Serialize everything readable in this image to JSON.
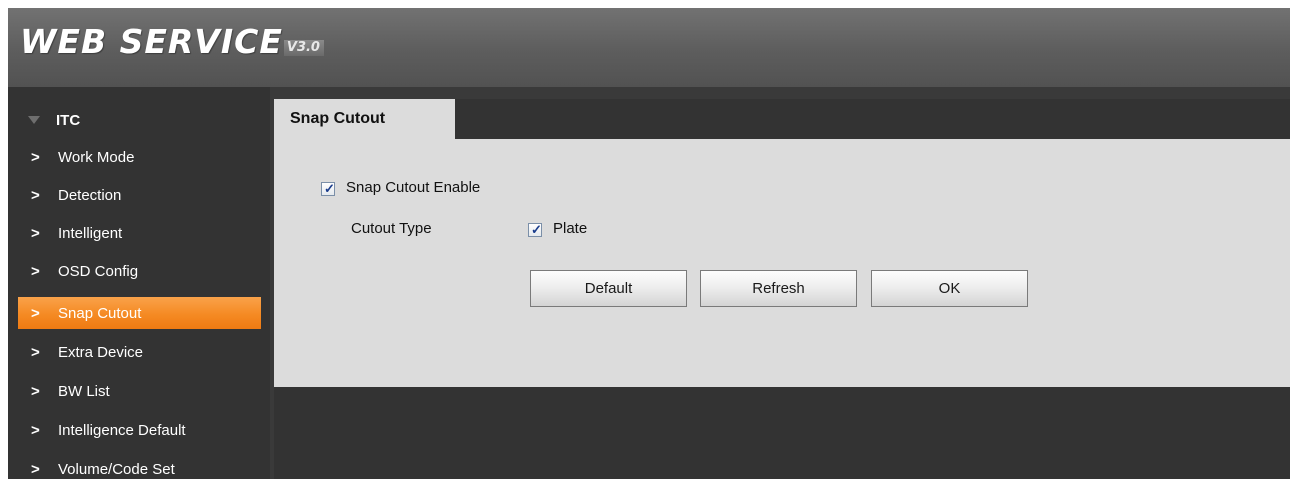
{
  "header": {
    "logo_text": "WEB  SERVICE",
    "logo_version": "V3.0"
  },
  "sidebar": {
    "group_label": "ITC",
    "items": [
      {
        "label": "Work Mode",
        "active": false
      },
      {
        "label": "Detection",
        "active": false
      },
      {
        "label": "Intelligent",
        "active": false
      },
      {
        "label": "OSD Config",
        "active": false
      },
      {
        "label": "Snap Cutout",
        "active": true
      },
      {
        "label": "Extra Device",
        "active": false
      },
      {
        "label": "BW List",
        "active": false
      },
      {
        "label": "Intelligence Default",
        "active": false
      },
      {
        "label": "Volume/Code Set",
        "active": false
      }
    ]
  },
  "main": {
    "tab_label": "Snap Cutout",
    "snap_cutout_enable": {
      "label": "Snap Cutout Enable",
      "checked": true
    },
    "cutout_type": {
      "label": "Cutout Type",
      "option_label": "Plate",
      "checked": true
    },
    "buttons": {
      "default": "Default",
      "refresh": "Refresh",
      "ok": "OK"
    }
  },
  "colors": {
    "accent": "#f58a23",
    "panel": "#dcdcdc",
    "background": "#333333",
    "header": "#606060"
  },
  "icons": {
    "collapse": "triangle-down-icon",
    "item": "chevron-right-icon",
    "check": "checkmark-icon"
  }
}
